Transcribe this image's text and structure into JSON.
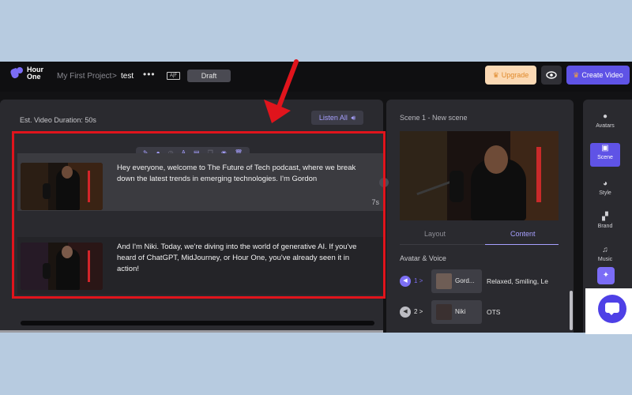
{
  "topbar": {
    "logo_line1": "Hour",
    "logo_line2": "One",
    "breadcrumb_project": "My First Project",
    "breadcrumb_sep": ">",
    "breadcrumb_current": "test",
    "more_glyph": "•••",
    "ar_glyph": "A|F",
    "draft_label": "Draft",
    "upgrade_label": "Upgrade",
    "create_label": "Create Video"
  },
  "left": {
    "est_duration": "Est. Video Duration: 50s",
    "listen_all": "Listen All",
    "toolbar_icons": [
      "magic-wand-icon",
      "mic-icon",
      "clock-icon",
      "text-icon",
      "layout-icon",
      "copy-icon",
      "eye-icon",
      "trash-icon"
    ],
    "scenes": [
      {
        "text": "Hey everyone, welcome to The Future of Tech podcast, where we break down the latest trends in emerging technologies. I'm Gordon",
        "duration": "7s"
      },
      {
        "text": "And I'm Niki. Today, we're diving into the world of generative AI. If you've heard of ChatGPT, MidJourney, or Hour One, you've already seen it in action!",
        "duration": ""
      }
    ]
  },
  "mid": {
    "scene_title": "Scene 1 - New scene",
    "tabs": [
      "Layout",
      "Content"
    ],
    "active_tab": "Content",
    "avatar_voice_title": "Avatar & Voice",
    "avatars": [
      {
        "num": "1 >",
        "name": "Gord...",
        "desc": "Relaxed, Smiling, Le"
      },
      {
        "num": "2 >",
        "name": "Niki",
        "desc": "OTS"
      }
    ]
  },
  "rail": {
    "items": [
      {
        "icon": "person-icon",
        "glyph": "👤",
        "label": "Avatars"
      },
      {
        "icon": "scene-icon",
        "glyph": "▣",
        "label": "Scene"
      },
      {
        "icon": "palette-icon",
        "glyph": "◕",
        "label": "Style"
      },
      {
        "icon": "brand-icon",
        "glyph": "▞",
        "label": "Brand"
      },
      {
        "icon": "music-icon",
        "glyph": "♫",
        "label": "Music"
      }
    ]
  },
  "colors": {
    "accent": "#5f53e6",
    "annotation_red": "#e0141c",
    "upgrade_bg": "#fbd9b4"
  }
}
